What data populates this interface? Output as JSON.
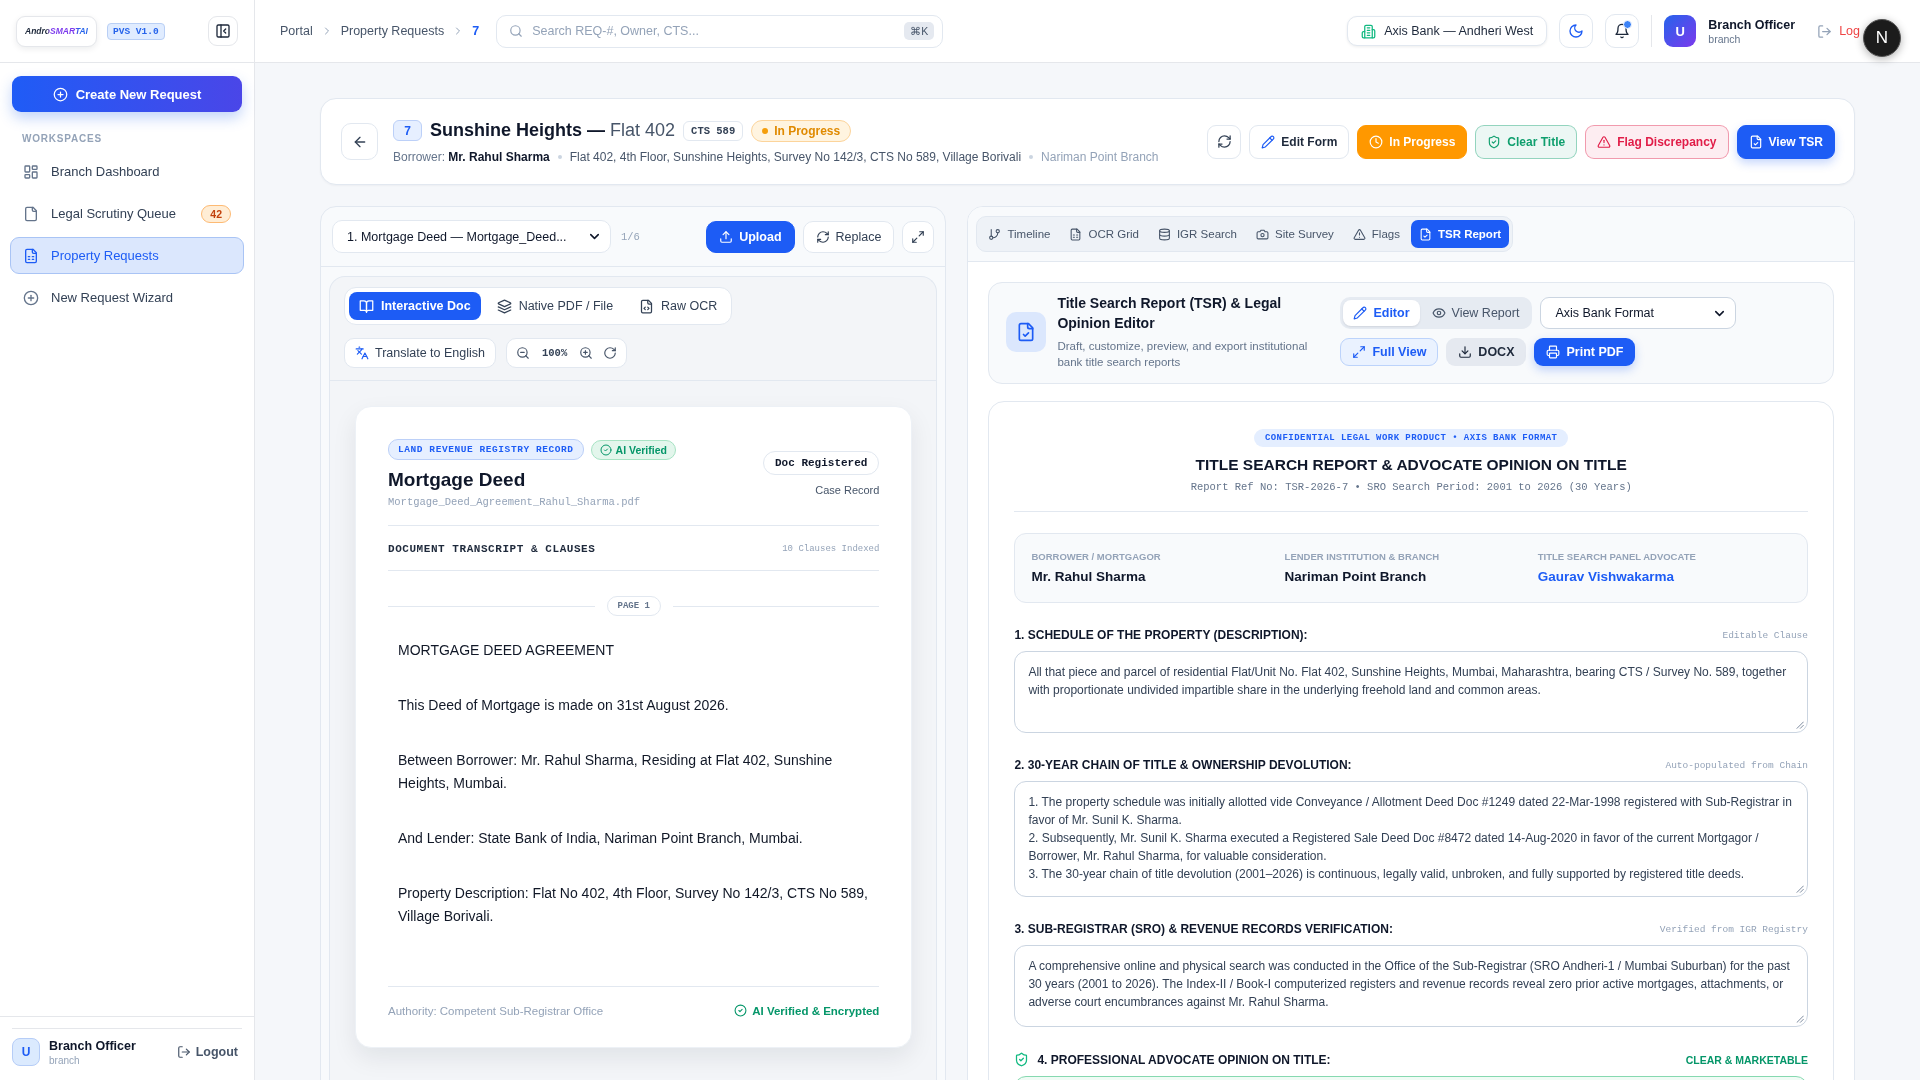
{
  "sidebar": {
    "logo": "AndroSMARTAI",
    "version": "PVS V1.0",
    "create_button": "Create New Request",
    "section_label": "WORKSPACES",
    "items": [
      {
        "label": "Branch Dashboard",
        "selected": false
      },
      {
        "label": "Legal Scrutiny Queue",
        "badge": "42",
        "selected": false
      },
      {
        "label": "Property Requests",
        "selected": true
      },
      {
        "label": "New Request Wizard",
        "selected": false
      }
    ],
    "user": {
      "initial": "U",
      "name": "Branch Officer",
      "role": "branch"
    },
    "logout": "Logout"
  },
  "topbar": {
    "breadcrumb": [
      {
        "label": "Portal",
        "current": false
      },
      {
        "label": "Property Requests",
        "current": false
      },
      {
        "label": "7",
        "current": true
      }
    ],
    "search": {
      "placeholder": "Search REQ-#, Owner, CTS...",
      "shortcut": "⌘K"
    },
    "branch": "Axis Bank — Andheri West",
    "notifications_unread": true,
    "user": {
      "initial": "U",
      "name": "Branch Officer",
      "role": "branch"
    },
    "logout": "Log",
    "dev_badge": "N"
  },
  "request": {
    "id": "7",
    "title": "Sunshine Heights —",
    "unit": "Flat 402",
    "cts": "CTS 589",
    "status": "In Progress",
    "borrower": "Borrower: **Mr. Rahul Sharma**",
    "address": "Flat 402, 4th Floor, Sunshine Heights, Survey No 142/3, CTS No 589, Village Borivali",
    "branch": "Nariman Point Branch",
    "actions": [
      {
        "kind": "refresh"
      },
      {
        "kind": "default",
        "label": "Edit Form"
      },
      {
        "kind": "status",
        "label": "In Progress",
        "color": "#ff9800",
        "selected": true
      },
      {
        "kind": "status",
        "label": "Clear Title",
        "color": "#0f9f6e",
        "selected": false
      },
      {
        "kind": "status",
        "label": "Flag Discrepancy",
        "color": "#e11d48",
        "selected": false
      },
      {
        "kind": "primary",
        "label": "View TSR"
      }
    ]
  },
  "document_panel": {
    "document_select": "1. Mortgage Deed — Mortgage_Deed...",
    "position": "1/6",
    "actions": [
      {
        "kind": "primary",
        "label": "Upload"
      },
      {
        "kind": "default",
        "label": "Replace"
      },
      {
        "kind": "icon"
      }
    ],
    "view_tabs": [
      {
        "label": "Interactive Doc",
        "selected": true
      },
      {
        "label": "Native PDF / File",
        "selected": false
      },
      {
        "label": "Raw OCR",
        "selected": false
      }
    ],
    "translate": "Translate to English",
    "zoom_level": "100%",
    "document": {
      "tags": [
        {
          "kind": "category",
          "label": "LAND REVENUE REGISTRY RECORD"
        },
        {
          "kind": "verified",
          "label": "AI Verified"
        }
      ],
      "title": "Mortgage Deed",
      "file": "Mortgage_Deed_Agreement_Rahul_Sharma.pdf",
      "stamp": "Doc Registered",
      "stamp_caption": "Case Record",
      "section_title": "DOCUMENT TRANSCRIPT & CLAUSES",
      "clause_count": "10 Clauses Indexed",
      "page_label": "PAGE 1",
      "paragraphs": [
        "MORTGAGE DEED AGREEMENT",
        "This Deed of Mortgage is made on 31st August 2026.",
        "Between Borrower: Mr. Rahul Sharma, Residing at Flat 402, Sunshine Heights, Mumbai.",
        "And Lender: State Bank of India, Nariman Point Branch, Mumbai.",
        "Property Description: Flat No 402, 4th Floor, Survey No 142/3, CTS No 589, Village Borivali."
      ],
      "authority": "Authority: Competent Sub-Registrar Office",
      "verification": "AI Verified & Encrypted"
    }
  },
  "detail_panel": {
    "tabs": [
      {
        "label": "Timeline",
        "selected": false
      },
      {
        "label": "OCR Grid",
        "selected": false
      },
      {
        "label": "IGR Search",
        "selected": false
      },
      {
        "label": "Site Survey",
        "selected": false
      },
      {
        "label": "Flags",
        "selected": false
      },
      {
        "label": "TSR Report",
        "selected": true
      }
    ],
    "editor": {
      "title": "Title Search Report (TSR) & Legal Opinion Editor",
      "description": "Draft, customize, preview, and export institutional bank title search reports",
      "modes": [
        {
          "label": "Editor",
          "selected": true
        },
        {
          "label": "View Report",
          "selected": false
        }
      ],
      "format": "Axis Bank Format",
      "actions": [
        {
          "kind": "outline",
          "label": "Full View"
        },
        {
          "kind": "secondary",
          "label": "DOCX"
        },
        {
          "kind": "primary",
          "label": "Print PDF"
        }
      ]
    },
    "report": {
      "banner": "CONFIDENTIAL LEGAL WORK PRODUCT • AXIS BANK FORMAT",
      "title": "TITLE SEARCH REPORT & ADVOCATE OPINION ON TITLE",
      "reference": "Report Ref No: TSR-2026-7 • SRO Search Period: 2001 to 2026 (30 Years)",
      "parties": [
        {
          "kind": "text",
          "label": "BORROWER / MORTGAGOR",
          "value": "Mr. Rahul Sharma"
        },
        {
          "kind": "text",
          "label": "LENDER INSTITUTION & BRANCH",
          "value": "Nariman Point Branch"
        },
        {
          "kind": "link",
          "label": "TITLE SEARCH PANEL ADVOCATE",
          "value": "Gaurav Vishwakarma"
        }
      ],
      "sections": [
        {
          "kind": "clause",
          "heading": "1. SCHEDULE OF THE PROPERTY (DESCRIPTION):",
          "note": "Editable Clause",
          "text": "All that piece and parcel of residential Flat/Unit No. Flat 402, Sunshine Heights, Mumbai, Maharashtra, bearing CTS / Survey No. 589, together with proportionate undivided impartible share in the underlying freehold land and common areas."
        },
        {
          "kind": "clause",
          "heading": "2. 30-YEAR CHAIN OF TITLE & OWNERSHIP DEVOLUTION:",
          "note": "Auto-populated from Chain",
          "text": "1. The property schedule was initially allotted vide Conveyance / Allotment Deed Doc #1249 dated 22-Mar-1998 registered with Sub-Registrar in favor of Mr. Sunil K. Sharma.\n2. Subsequently, Mr. Sunil K. Sharma executed a Registered Sale Deed Doc #8472 dated 14-Aug-2020 in favor of the current Mortgagor / Borrower, Mr. Rahul Sharma, for valuable consideration.\n3. The 30-year chain of title devolution (2001–2026) is continuous, legally valid, unbroken, and fully supported by registered title deeds."
        },
        {
          "kind": "clause",
          "heading": "3. SUB-REGISTRAR (SRO) & REVENUE RECORDS VERIFICATION:",
          "note": "Verified from IGR Registry",
          "text": "A comprehensive online and physical search was conducted in the Office of the Sub-Registrar (SRO Andheri-1 / Mumbai Suburban) for the past 30 years (2001 to 2026). The Index-II / Book-I computerized registers and revenue records reveal zero prior active mortgages, attachments, or adverse court encumbrances against Mr. Rahul Sharma."
        },
        {
          "kind": "opinion",
          "heading": "4. PROFESSIONAL ADVOCATE OPINION ON TITLE:",
          "note": "CLEAR & MARKETABLE"
        }
      ]
    }
  }
}
